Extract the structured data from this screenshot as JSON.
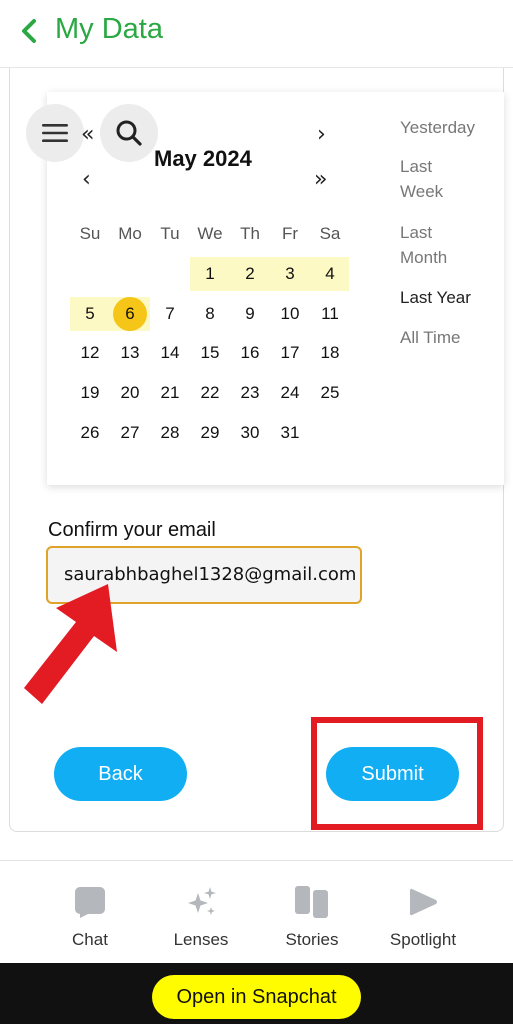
{
  "header": {
    "title": "My Data"
  },
  "calendar": {
    "month_title": "May 2024",
    "nav": {
      "prev_year": "«",
      "next_month": "›",
      "prev_month": "‹",
      "next_year": "»"
    },
    "weekdays": [
      "Su",
      "Mo",
      "Tu",
      "We",
      "Th",
      "Fr",
      "Sa"
    ],
    "weeks": [
      [
        "",
        "",
        "",
        "1",
        "2",
        "3",
        "4"
      ],
      [
        "5",
        "6",
        "7",
        "8",
        "9",
        "10",
        "11"
      ],
      [
        "12",
        "13",
        "14",
        "15",
        "16",
        "17",
        "18"
      ],
      [
        "19",
        "20",
        "21",
        "22",
        "23",
        "24",
        "25"
      ],
      [
        "26",
        "27",
        "28",
        "29",
        "30",
        "31",
        ""
      ]
    ],
    "selected_day": "6",
    "highlight_color": "#fdf9c4",
    "selected_color": "#f5c518"
  },
  "ranges": {
    "yesterday": "Yesterday",
    "last_week_1": "Last",
    "last_week_2": "Week",
    "last_month_1": "Last",
    "last_month_2": "Month",
    "last_year": "Last Year",
    "all_time": "All Time",
    "active": "Last Year"
  },
  "email": {
    "label": "Confirm your email",
    "value": "saurabhbaghel1328@gmail.com"
  },
  "buttons": {
    "back": "Back",
    "submit": "Submit"
  },
  "bottom_nav": [
    {
      "label": "Chat",
      "icon": "chat-icon"
    },
    {
      "label": "Lenses",
      "icon": "lenses-sparkle-icon"
    },
    {
      "label": "Stories",
      "icon": "stories-icon"
    },
    {
      "label": "Spotlight",
      "icon": "spotlight-play-icon"
    }
  ],
  "footer": {
    "open_label": "Open in Snapchat"
  },
  "colors": {
    "title_green": "#2ba843",
    "button_blue": "#12aef3",
    "annotation_red": "#e31b23",
    "snap_yellow": "#fffc00",
    "email_border": "#e0a32a"
  }
}
